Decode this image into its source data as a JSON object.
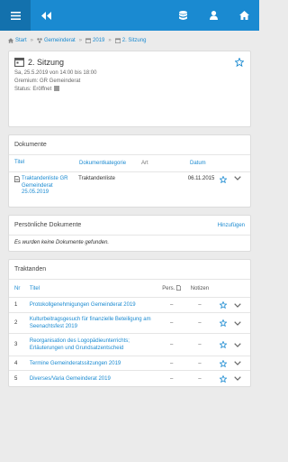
{
  "breadcrumb": [
    {
      "label": "Start",
      "icon": "home-icon"
    },
    {
      "label": "Gemeinderat",
      "icon": "org-icon"
    },
    {
      "label": "2019",
      "icon": "calendar-icon"
    },
    {
      "label": "2. Sitzung",
      "icon": "calendar-icon"
    }
  ],
  "session": {
    "title": "2. Sitzung",
    "datetime": "Sa, 25.5.2019 von 14:00 bis 18:00",
    "gremium": "Gremium: GR Gemeinderat",
    "status": "Status: Eröffnet"
  },
  "documents": {
    "heading": "Dokumente",
    "columns": {
      "title": "Titel",
      "category": "Dokumentkategorie",
      "art": "Art",
      "date": "Datum"
    },
    "rows": [
      {
        "title": "Traktandenliste GR Gemeinderat 25.05.2019",
        "category": "Traktandenliste",
        "art": "",
        "date": "06.11.2015"
      }
    ]
  },
  "personal": {
    "heading": "Persönliche Dokumente",
    "add_label": "Hinzufügen",
    "empty_text": "Es wurden keine Dokumente gefunden."
  },
  "agenda": {
    "heading": "Traktanden",
    "columns": {
      "nr": "Nr",
      "title": "Titel",
      "pers": "Pers.",
      "notes": "Notizen"
    },
    "rows": [
      {
        "nr": "1",
        "title": "Protokollgenehmigungen Gemeinderat 2019",
        "pers": "–",
        "notes": "–"
      },
      {
        "nr": "2",
        "title": "Kulturbeitragsgesuch für finanzielle Beteiligung am Seenachtsfest 2019",
        "pers": "–",
        "notes": "–"
      },
      {
        "nr": "3",
        "title": "Reorganisation des Logopädieunterrichts; Erläuterungen und Grundsatzentscheid",
        "pers": "–",
        "notes": "–"
      },
      {
        "nr": "4",
        "title": "Termine Gemeinderatssitzungen 2019",
        "pers": "–",
        "notes": "–"
      },
      {
        "nr": "5",
        "title": "Diverses/Varia Gemeinderat 2019",
        "pers": "–",
        "notes": "–"
      }
    ]
  },
  "colors": {
    "primary": "#1a8ad1",
    "primary_dark": "#1371ad",
    "background": "#ebebeb"
  }
}
